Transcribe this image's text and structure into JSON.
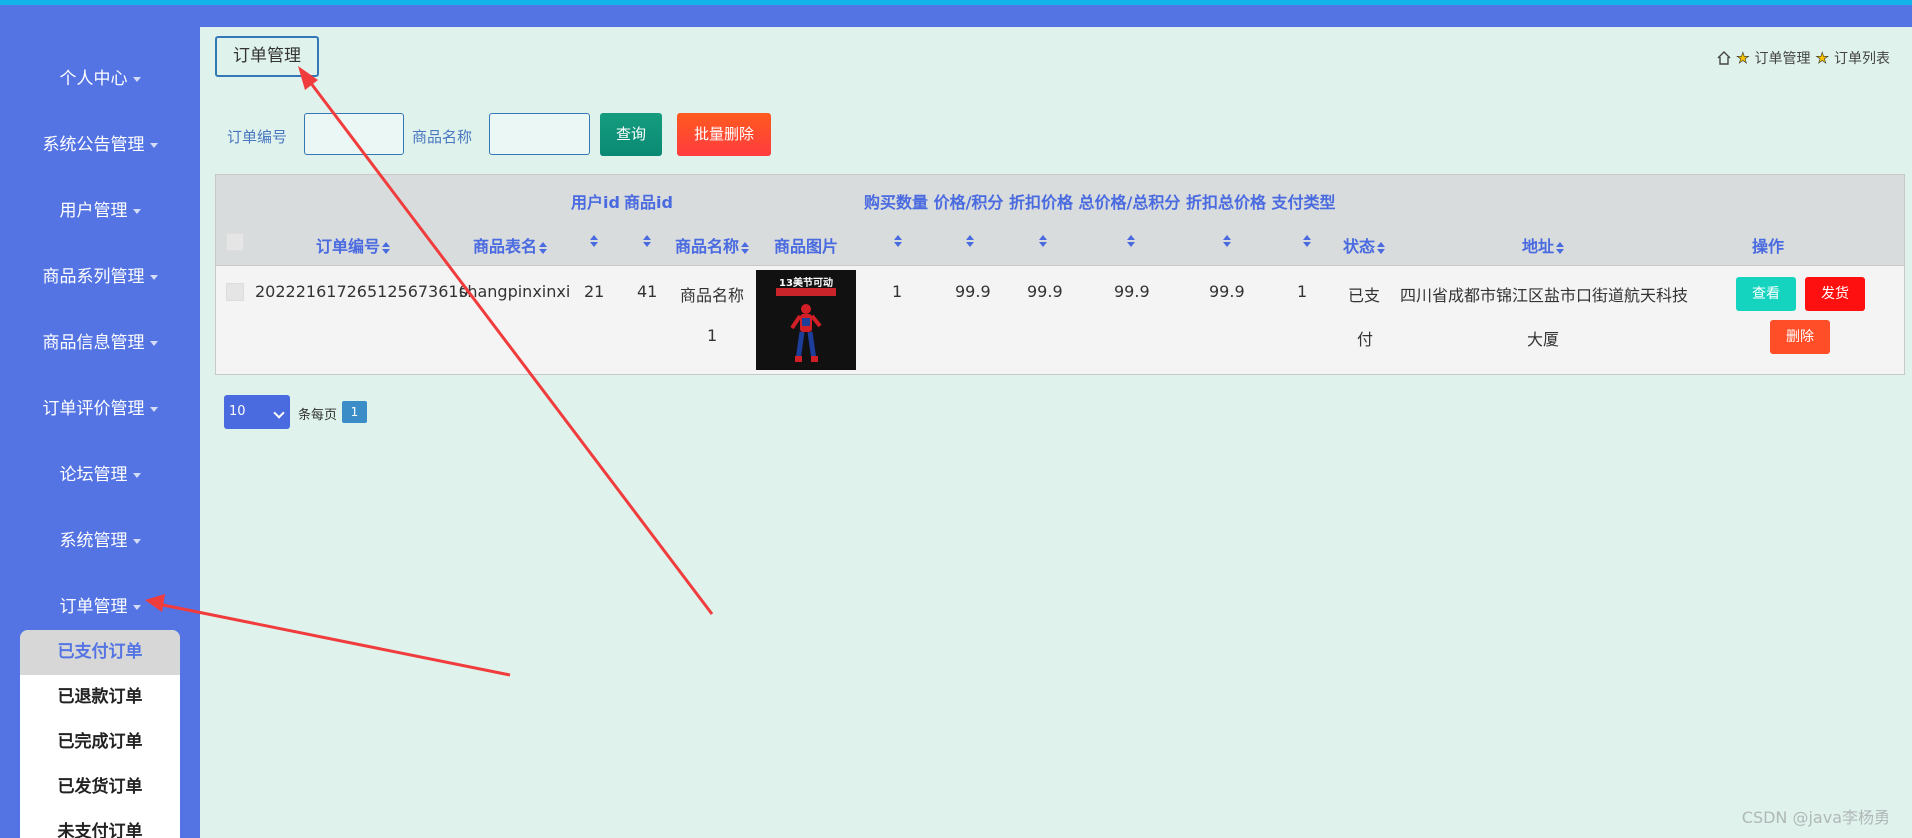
{
  "sidebar": {
    "items": [
      {
        "label": "个人中心"
      },
      {
        "label": "系统公告管理"
      },
      {
        "label": "用户管理"
      },
      {
        "label": "商品系列管理"
      },
      {
        "label": "商品信息管理"
      },
      {
        "label": "订单评价管理"
      },
      {
        "label": "论坛管理"
      },
      {
        "label": "系统管理"
      },
      {
        "label": "订单管理"
      }
    ],
    "submenu": [
      {
        "label": "已支付订单"
      },
      {
        "label": "已退款订单"
      },
      {
        "label": "已完成订单"
      },
      {
        "label": "已发货订单"
      },
      {
        "label": "未支付订单"
      }
    ]
  },
  "header": {
    "title_button": "订单管理",
    "breadcrumb": [
      "订单管理",
      "订单列表"
    ]
  },
  "search": {
    "order_no_label": "订单编号",
    "order_no_value": "",
    "product_name_label": "商品名称",
    "product_name_value": "",
    "query_button": "查询",
    "batch_delete_button": "批量删除"
  },
  "table": {
    "top_headers": {
      "user_id": "用户id",
      "product_id": "商品id",
      "group": "购买数量 价格/积分 折扣价格 总价格/总积分 折扣总价格 支付类型"
    },
    "headers": {
      "order_no": "订单编号",
      "table_name": "商品表名",
      "product_name": "商品名称",
      "product_image": "商品图片",
      "status": "状态",
      "address": "地址",
      "actions": "操作"
    },
    "row": {
      "order_no": "20222161726512567361​0",
      "table_name": "shangpinxinxi",
      "user_id": "21",
      "product_id": "41",
      "product_name_line1": "商品名称",
      "product_name_line2": "1",
      "image_title": "13美节可动",
      "image_subtitle": "",
      "quantity": "1",
      "price": "99.9",
      "discount_price": "99.9",
      "total_price": "99.9",
      "discount_total": "99.9",
      "pay_type": "1",
      "status_line1": "已支",
      "status_line2": "付",
      "address_line1": "四川省成都市锦江区盐市口街道航天科技",
      "address_line2": "大厦",
      "view_button": "查看",
      "ship_button": "发货",
      "delete_button": "删除"
    }
  },
  "pagination": {
    "page_size": "10",
    "per_page_label": "条每页",
    "current_page": "1"
  },
  "watermark": "CSDN @java李杨勇",
  "colors": {
    "sidebar": "#5474e4",
    "background": "#dff2ec",
    "header_text": "#4a6ae0",
    "query": "#0f937a",
    "batch_delete": "#ff4a2e",
    "view": "#14d4c0",
    "ship": "#ff1010",
    "delete": "#ff4e28",
    "annotation_arrow": "#f03c3c"
  }
}
